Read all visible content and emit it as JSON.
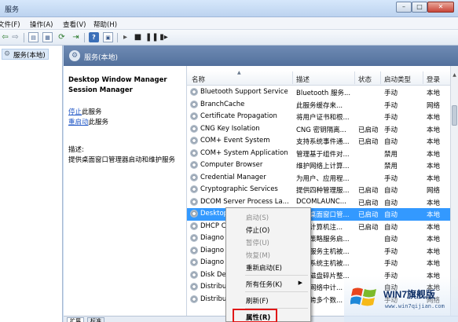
{
  "window": {
    "title": "服务",
    "controls": {
      "minimize": "–",
      "maximize": "□",
      "close": "✕"
    }
  },
  "menubar": {
    "items": [
      "文件(F)",
      "操作(A)",
      "查看(V)",
      "帮助(H)"
    ]
  },
  "toolbar": {
    "icons": [
      "back-icon",
      "forward-icon",
      "console-tree-icon",
      "properties-icon",
      "refresh-icon",
      "export-icon",
      "help-icon",
      "console-icon",
      "play-icon",
      "stop-icon",
      "pause-icon",
      "restart-icon"
    ]
  },
  "tree": {
    "item": "服务(本地)"
  },
  "header": {
    "title": "服务(本地)"
  },
  "details": {
    "service_name": "Desktop Window Manager Session Manager",
    "stop_link": "停止",
    "stop_suffix": "此服务",
    "restart_link": "重启动",
    "restart_suffix": "此服务",
    "desc_label": "描述:",
    "desc_text": "提供桌面窗口管理器启动和维护服务"
  },
  "table": {
    "columns": [
      "名称",
      "描述",
      "状态",
      "启动类型",
      "登录"
    ],
    "rows": [
      {
        "name": "Bluetooth Support Service",
        "desc": "Bluetooth 服务...",
        "status": "",
        "startup": "手动",
        "logon": "本地"
      },
      {
        "name": "BranchCache",
        "desc": "此服务缓存来...",
        "status": "",
        "startup": "手动",
        "logon": "网络"
      },
      {
        "name": "Certificate Propagation",
        "desc": "将用户证书和根...",
        "status": "",
        "startup": "手动",
        "logon": "本地"
      },
      {
        "name": "CNG Key Isolation",
        "desc": "CNG 密钥隔离...",
        "status": "已启动",
        "startup": "手动",
        "logon": "本地"
      },
      {
        "name": "COM+ Event System",
        "desc": "支持系统事件通...",
        "status": "已启动",
        "startup": "自动",
        "logon": "本地"
      },
      {
        "name": "COM+ System Application",
        "desc": "管理基于组件对...",
        "status": "",
        "startup": "禁用",
        "logon": "本地"
      },
      {
        "name": "Computer Browser",
        "desc": "维护网络上计算...",
        "status": "",
        "startup": "禁用",
        "logon": "本地"
      },
      {
        "name": "Credential Manager",
        "desc": "为用户、应用程...",
        "status": "",
        "startup": "手动",
        "logon": "本地"
      },
      {
        "name": "Cryptographic Services",
        "desc": "提供四种管理服...",
        "status": "已启动",
        "startup": "自动",
        "logon": "网络"
      },
      {
        "name": "DCOM Server Process La...",
        "desc": "DCOMLAUNC...",
        "status": "已启动",
        "startup": "自动",
        "logon": "本地"
      },
      {
        "name": "Desktop",
        "desc": "提供桌面窗口管...",
        "status": "已启动",
        "startup": "自动",
        "logon": "本地"
      },
      {
        "name": "DHCP C",
        "desc": "为此计算机注...",
        "status": "已启动",
        "startup": "自动",
        "logon": "本地"
      },
      {
        "name": "Diagno",
        "desc": "诊断策略服务启...",
        "status": "",
        "startup": "自动",
        "logon": "本地"
      },
      {
        "name": "Diagno",
        "desc": "诊断服务主机被...",
        "status": "",
        "startup": "手动",
        "logon": "本地"
      },
      {
        "name": "Diagno",
        "desc": "诊断系统主机被...",
        "status": "",
        "startup": "手动",
        "logon": "本地"
      },
      {
        "name": "Disk De",
        "desc": "提供磁盘碎片整...",
        "status": "",
        "startup": "手动",
        "logon": "本地"
      },
      {
        "name": "Distribu",
        "desc": "维护网络中计...",
        "status": "",
        "startup": "自动",
        "logon": "本地"
      },
      {
        "name": "Distribu",
        "desc": "协调跨多个数...",
        "status": "",
        "startup": "手动",
        "logon": "网络"
      }
    ]
  },
  "context_menu": {
    "items": [
      {
        "label": "启动(S)",
        "enabled": false
      },
      {
        "label": "停止(O)",
        "enabled": true
      },
      {
        "label": "暂停(U)",
        "enabled": false
      },
      {
        "label": "恢复(M)",
        "enabled": false
      },
      {
        "label": "重新启动(E)",
        "enabled": true
      },
      {
        "label": "所有任务(K)",
        "enabled": true,
        "submenu": "▶"
      },
      {
        "label": "刷新(F)",
        "enabled": true
      },
      {
        "label": "属性(R)",
        "enabled": true
      }
    ]
  },
  "tabs": [
    "扩展",
    "标准"
  ],
  "watermark": {
    "name": "WIN7旗舰版",
    "url": "www.win7qijian.com"
  },
  "colors": {
    "selection": "#3399ff",
    "highlight_box": "#e01818",
    "header_band": "#5f7da8"
  }
}
